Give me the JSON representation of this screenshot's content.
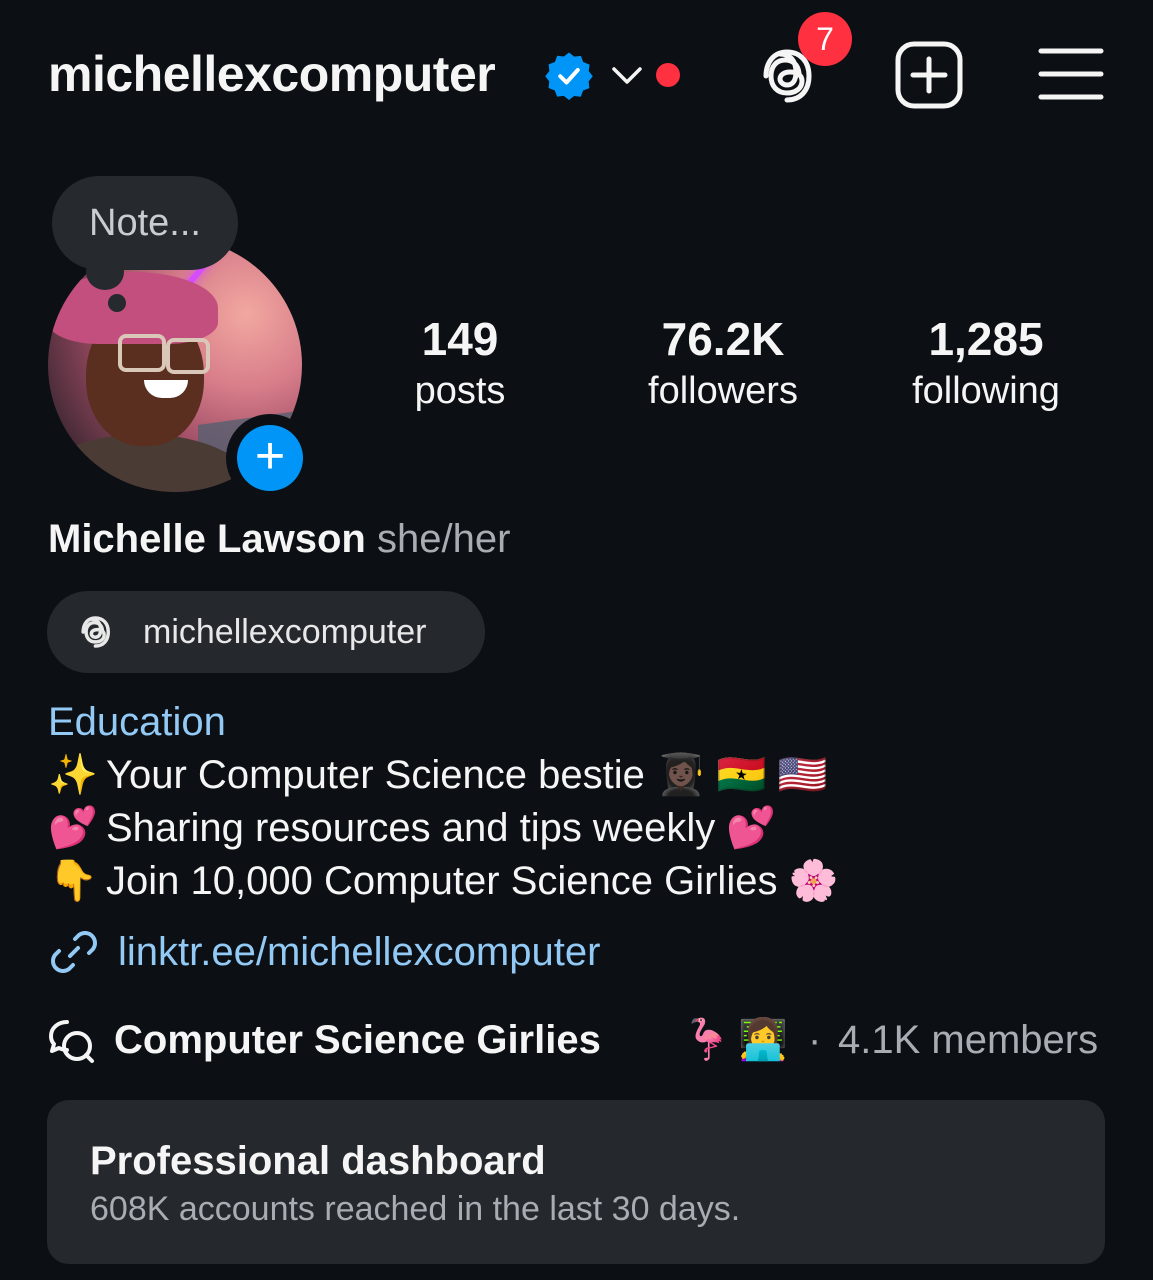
{
  "header": {
    "username": "michellexcomputer",
    "notification_count": "7",
    "icons": [
      "verified-badge-icon",
      "chevron-down-icon",
      "threads-icon",
      "add-square-icon",
      "menu-icon"
    ],
    "accent_live_dot": "#ff3040"
  },
  "note": {
    "placeholder": "Note..."
  },
  "stats": {
    "posts": {
      "value": "149",
      "label": "posts"
    },
    "followers": {
      "value": "76.2K",
      "label": "followers"
    },
    "following": {
      "value": "1,285",
      "label": "following"
    }
  },
  "profile": {
    "full_name": "Michelle Lawson",
    "pronouns": "she/her",
    "threads_handle": "michellexcomputer",
    "category": "Education",
    "bio": [
      {
        "emoji": "✨",
        "text": "Your Computer Science bestie 👩🏿‍🎓 🇬🇭 🇺🇸"
      },
      {
        "emoji": "💕",
        "text": "Sharing resources and tips weekly 💕"
      },
      {
        "emoji": "👇",
        "text": "Join 10,000 Computer Science Girlies 🌸"
      }
    ],
    "link": "linktr.ee/michellexcomputer"
  },
  "channel": {
    "name": "Computer Science Girlies",
    "emoji1": "🦩",
    "emoji2": "👩‍💻",
    "separator": "·",
    "members": "4.1K members"
  },
  "dashboard": {
    "title": "Professional dashboard",
    "subtitle": "608K accounts reached in the last 30 days."
  },
  "colors": {
    "background": "#0c1014",
    "link": "#92c9f5",
    "verified": "#0095f6",
    "badge": "#ff3040",
    "card": "#25292e"
  }
}
